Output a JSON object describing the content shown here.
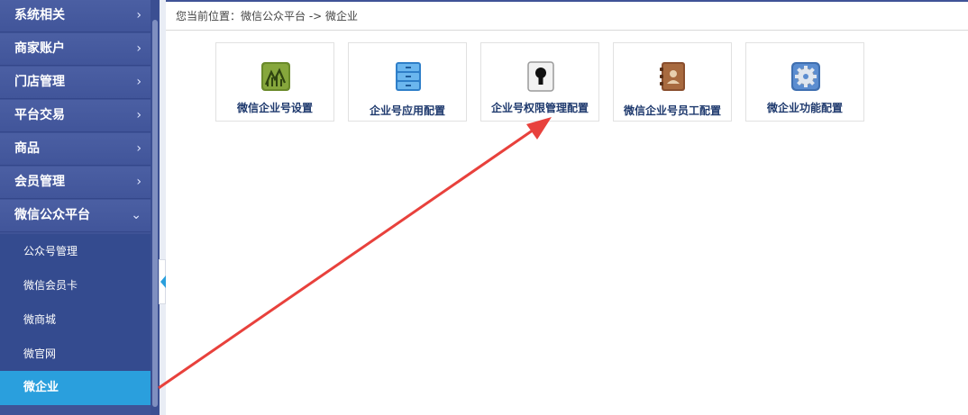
{
  "sidebar": {
    "menu": [
      {
        "label": "系统相关",
        "chevron": "›"
      },
      {
        "label": "商家账户",
        "chevron": "›"
      },
      {
        "label": "门店管理",
        "chevron": "›"
      },
      {
        "label": "平台交易",
        "chevron": "›"
      },
      {
        "label": "商品",
        "chevron": "›"
      },
      {
        "label": "会员管理",
        "chevron": "›"
      },
      {
        "label": "微信公众平台",
        "chevron": "⌄"
      }
    ],
    "submenu": [
      {
        "label": "公众号管理"
      },
      {
        "label": "微信会员卡"
      },
      {
        "label": "微商城"
      },
      {
        "label": "微官网"
      },
      {
        "label": "微企业",
        "active": true
      }
    ]
  },
  "breadcrumb": "您当前位置：微信公众平台 -> 微企业",
  "tiles": [
    {
      "label": "微信企业号设置",
      "icon": "chart-icon"
    },
    {
      "label": "企业号应用配置",
      "icon": "filing-cabinet-icon"
    },
    {
      "label": "企业号权限管理配置",
      "icon": "keyhole-lock-icon"
    },
    {
      "label": "微信企业号员工配置",
      "icon": "address-book-icon"
    },
    {
      "label": "微企业功能配置",
      "icon": "gear-icon"
    }
  ],
  "colors": {
    "sidebar_bg": "#3f5397",
    "active_item": "#2a9fdd",
    "annotation_arrow": "#e8413c",
    "tile_label": "#1f3a6e"
  }
}
